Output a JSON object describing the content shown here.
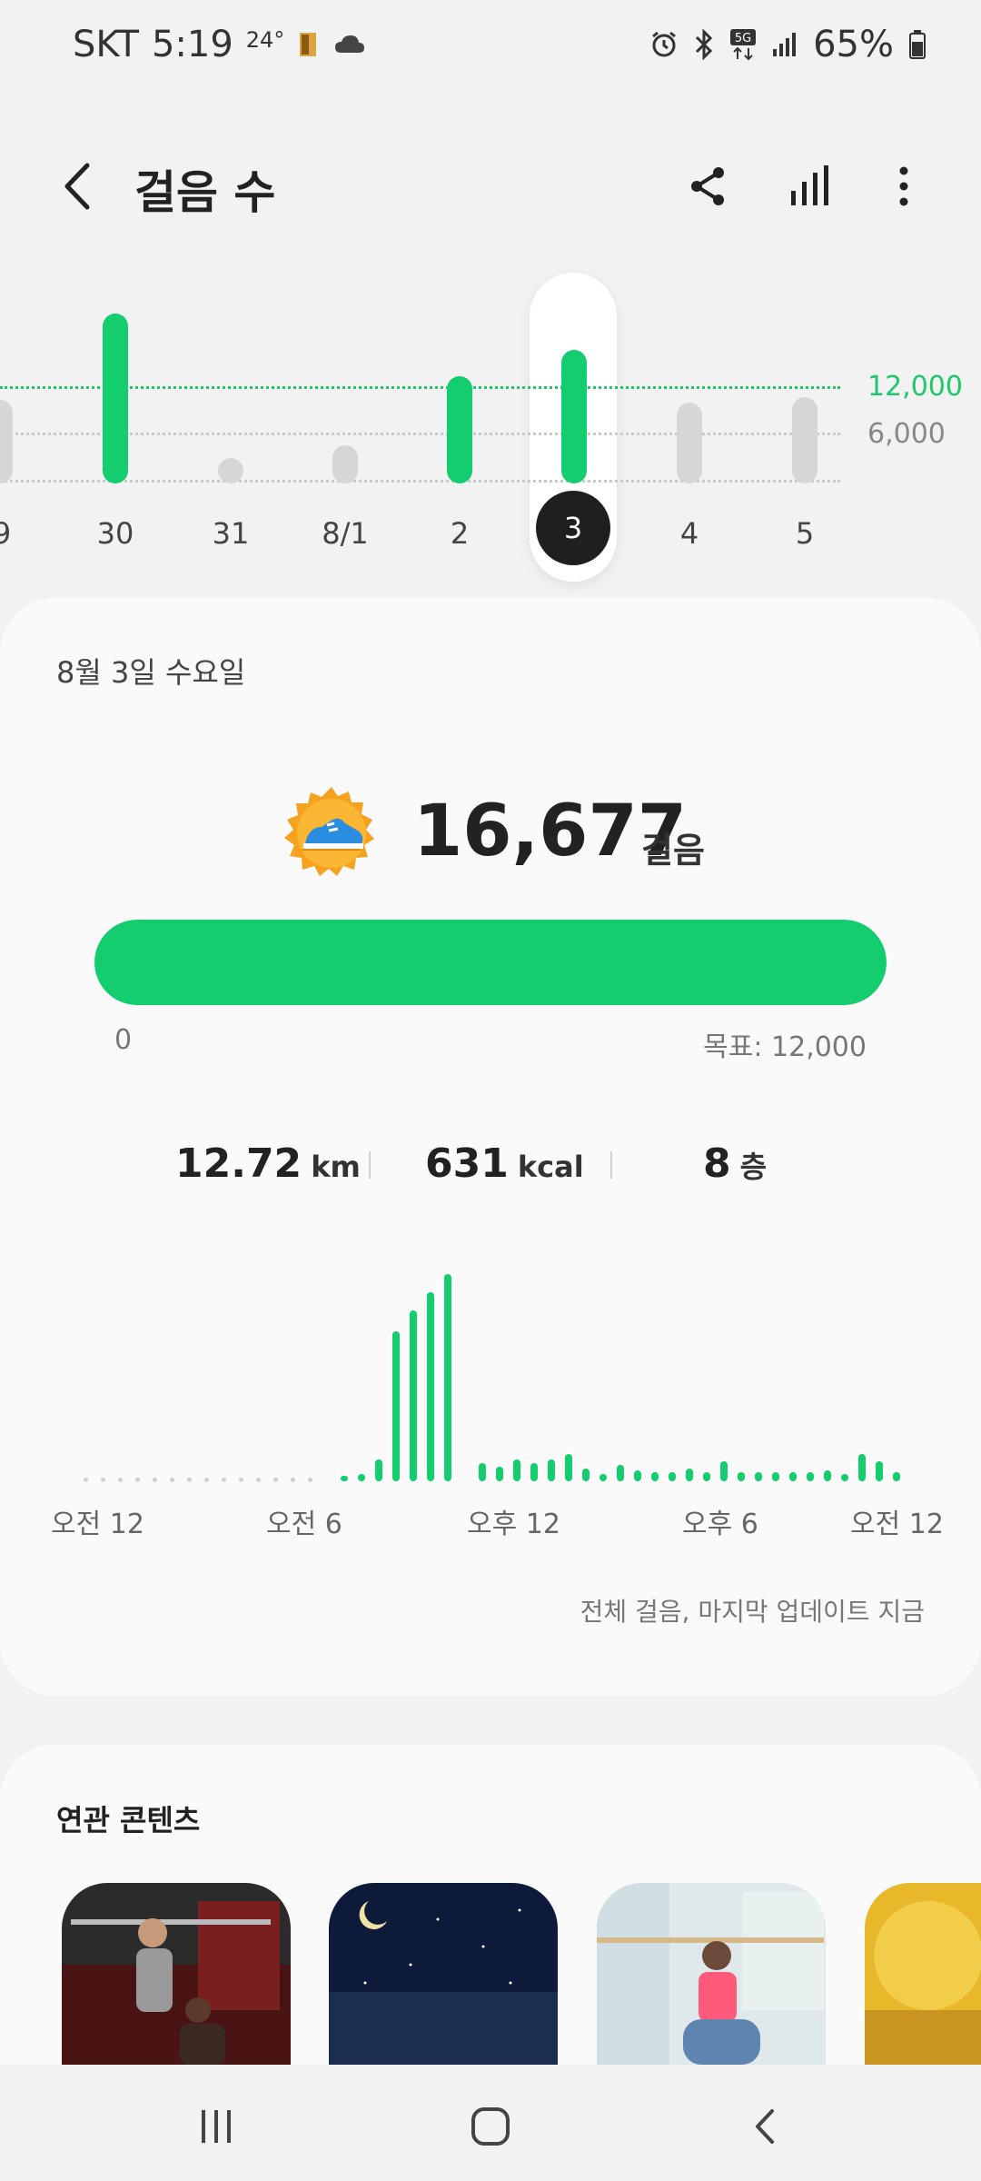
{
  "status_bar": {
    "carrier": "SKT",
    "time": "5:19",
    "temperature": "24°",
    "battery": "65%"
  },
  "header": {
    "title": "걸음 수",
    "icons": [
      "back-arrow-icon",
      "share-icon",
      "bar-chart-icon",
      "more-options-icon"
    ]
  },
  "weekly_chart": {
    "goal_label": "12,000",
    "mid_label": "6,000",
    "goal_color": "#1ec86a",
    "days": [
      "9",
      "30",
      "31",
      "8/1",
      "2",
      "3",
      "4",
      "5"
    ],
    "selected_day": "3"
  },
  "summary": {
    "date": "8월 3일 수요일",
    "steps": "16,677",
    "steps_unit": "걸음",
    "progress_start": "0",
    "goal_text": "목표: 12,000",
    "progress_fraction": 1.0
  },
  "stats": {
    "distance_value": "12.72",
    "distance_unit": "km",
    "calories_value": "631",
    "calories_unit": "kcal",
    "floors_value": "8",
    "floors_unit": "층"
  },
  "hourly_chart": {
    "labels": [
      "오전 12",
      "오전 6",
      "오후 12",
      "오후 6",
      "오전 12"
    ]
  },
  "updated_text": "전체 걸음, 마지막 업데이트 지금",
  "related": {
    "title": "연관 콘텐츠"
  },
  "colors": {
    "accent": "#14cd6e",
    "inactive_bar": "#d6d6d6"
  }
}
